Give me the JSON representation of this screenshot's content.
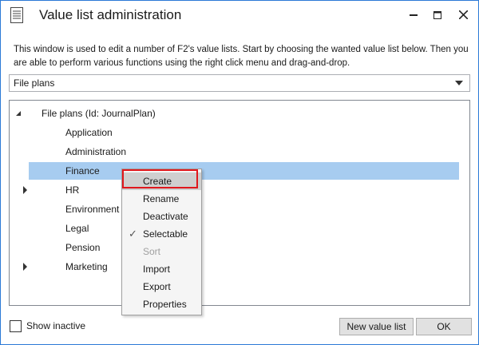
{
  "window": {
    "title": "Value list administration",
    "app_icon": "document-list-icon",
    "minimize_icon": "minimize-icon",
    "maximize_icon": "maximize-icon",
    "close_icon": "close-icon"
  },
  "description": "This window is used to edit a number of F2's value lists. Start by choosing the wanted value list below. Then you are able to perform various functions using the right click menu and drag-and-drop.",
  "value_list_select": {
    "selected": "File plans"
  },
  "tree": {
    "root": {
      "label": "File plans (Id: JournalPlan)",
      "expanded": true
    },
    "children": [
      {
        "label": "Application",
        "has_children": false,
        "selected": false
      },
      {
        "label": "Administration",
        "has_children": false,
        "selected": false
      },
      {
        "label": "Finance",
        "has_children": false,
        "selected": true
      },
      {
        "label": "HR",
        "has_children": true,
        "selected": false
      },
      {
        "label": "Environment",
        "has_children": false,
        "selected": false
      },
      {
        "label": "Legal",
        "has_children": false,
        "selected": false
      },
      {
        "label": "Pension",
        "has_children": false,
        "selected": false
      },
      {
        "label": "Marketing",
        "has_children": true,
        "selected": false
      }
    ]
  },
  "context_menu": {
    "items": [
      {
        "label": "Create",
        "highlighted": true,
        "disabled": false,
        "checked": false
      },
      {
        "label": "Rename",
        "highlighted": false,
        "disabled": false,
        "checked": false
      },
      {
        "label": "Deactivate",
        "highlighted": false,
        "disabled": false,
        "checked": false
      },
      {
        "label": "Selectable",
        "highlighted": false,
        "disabled": false,
        "checked": true
      },
      {
        "label": "Sort",
        "highlighted": false,
        "disabled": true,
        "checked": false
      },
      {
        "label": "Import",
        "highlighted": false,
        "disabled": false,
        "checked": false
      },
      {
        "label": "Export",
        "highlighted": false,
        "disabled": false,
        "checked": false
      },
      {
        "label": "Properties",
        "highlighted": false,
        "disabled": false,
        "checked": false
      }
    ],
    "annotation_color": "#e0171d"
  },
  "footer": {
    "show_inactive_label": "Show inactive",
    "show_inactive_checked": false,
    "new_value_list_label": "New value list",
    "ok_label": "OK"
  },
  "colors": {
    "accent": "#2b79d6",
    "selection": "#a7ccf0"
  }
}
